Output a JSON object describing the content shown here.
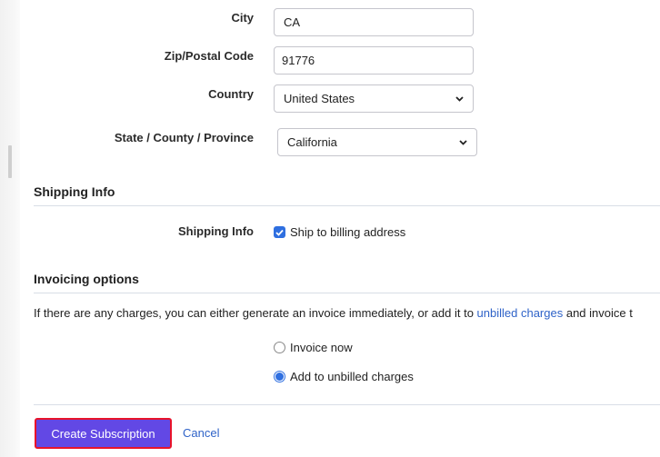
{
  "form": {
    "fields": [
      {
        "label": "City",
        "type": "text",
        "value": "CA"
      },
      {
        "label": "Zip/Postal Code",
        "type": "text",
        "value": "91776"
      },
      {
        "label": "Country",
        "type": "select",
        "value": "United States"
      },
      {
        "label": "State / County / Province",
        "type": "select",
        "value": "California"
      }
    ]
  },
  "shipping": {
    "section_title": "Shipping Info",
    "field_label": "Shipping Info",
    "checkbox_label": "Ship to billing address",
    "checked": true
  },
  "invoicing": {
    "section_title": "Invoicing options",
    "description_before": "If there are any charges, you can either generate an invoice immediately, or add it to ",
    "description_link": "unbilled charges",
    "description_after": " and invoice t",
    "options": [
      {
        "label": "Invoice now",
        "selected": false
      },
      {
        "label": "Add to unbilled charges",
        "selected": true
      }
    ]
  },
  "actions": {
    "primary_label": "Create Subscription",
    "cancel_label": "Cancel"
  },
  "colors": {
    "primary": "#6248e5",
    "primary_highlight_border": "#e8132b",
    "link": "#2f63c8",
    "accent_control": "#2f6fe0"
  }
}
